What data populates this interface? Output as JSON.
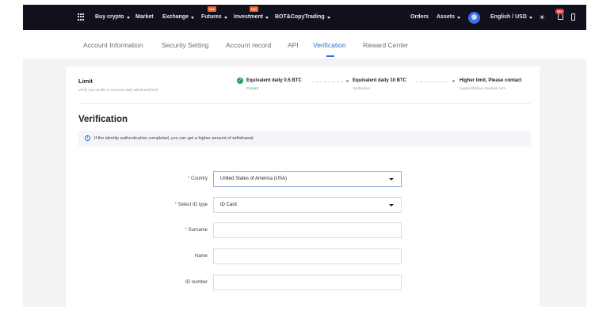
{
  "topbar": {
    "nav": [
      {
        "label": "Buy crypto",
        "caret": true
      },
      {
        "label": "Market",
        "caret": false
      },
      {
        "label": "Exchange",
        "caret": true
      },
      {
        "label": "Futures",
        "caret": true,
        "badge": "Hot"
      },
      {
        "label": "Investment",
        "caret": true,
        "badge": "Hot"
      },
      {
        "label": "BOT&CopyTrading",
        "caret": true
      }
    ],
    "right": {
      "orders": "Orders",
      "assets": "Assets",
      "language": "English / USD",
      "notification_count": "99+"
    }
  },
  "tabs": [
    {
      "label": "Account Information"
    },
    {
      "label": "Security Setting"
    },
    {
      "label": "Account record"
    },
    {
      "label": "API"
    },
    {
      "label": "Verification",
      "active": true
    },
    {
      "label": "Reward Center"
    }
  ],
  "limit": {
    "title": "Limit",
    "subtitle": "Verify your profile to increase daily withdrawal limit.",
    "steps": [
      {
        "label": "Equivalent daily   0.5 BTC",
        "sub": "Current",
        "done": true
      },
      {
        "label": "Equivalent daily   10 BTC",
        "sub": "Verification",
        "done": false
      },
      {
        "label": "Higher limit,   Please contact",
        "sub": "support@bibox.zendesk.com",
        "done": false
      }
    ]
  },
  "verification": {
    "title": "Verification",
    "notice": "If the identity authentication completed, you can get a higher amount of withdrawal.",
    "fields": {
      "country": {
        "label": "Country",
        "required": true,
        "value": "United States of America (USA)"
      },
      "id_type": {
        "label": "Select ID type",
        "required": true,
        "value": "ID Card"
      },
      "surname": {
        "label": "Surname",
        "required": true,
        "value": ""
      },
      "name": {
        "label": "Name",
        "required": false,
        "value": ""
      },
      "id_number": {
        "label": "ID number",
        "required": false,
        "value": ""
      }
    }
  },
  "colors": {
    "topbar_bg": "#11111d",
    "accent": "#2f6fd6",
    "success": "#23a05a",
    "hot_badge": "#e5652e",
    "required": "#e83b3b"
  }
}
